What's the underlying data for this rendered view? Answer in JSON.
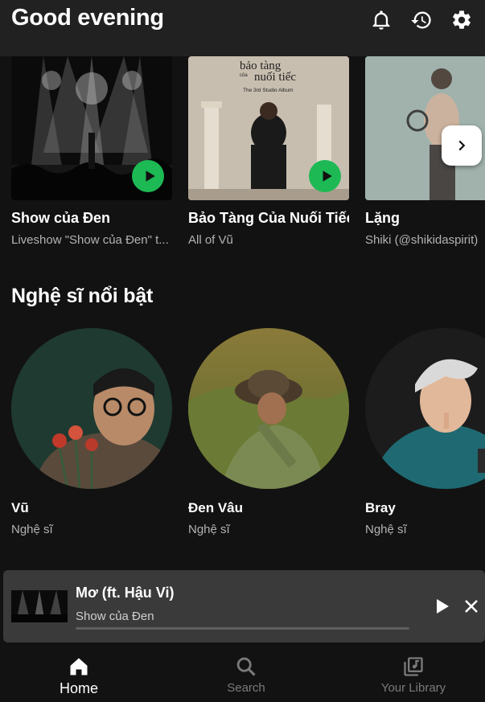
{
  "header": {
    "greeting": "Good evening",
    "icons": [
      "bell-icon",
      "history-icon",
      "settings-icon"
    ]
  },
  "albums": [
    {
      "title": "Show của Đen",
      "subtitle": "Liveshow \"Show của Đen\" t...",
      "has_play": true
    },
    {
      "title": "Bảo Tàng Của Nuối Tiếc",
      "subtitle": "All of Vũ",
      "has_play": true,
      "art_text_1": "bảo tàng",
      "art_text_2": "của",
      "art_text_3": "nuối tiếc",
      "art_text_4": "The 3rd Studio Album"
    },
    {
      "title": "Lặng",
      "subtitle": "Shiki (@shikidaspirit)",
      "has_play": false
    }
  ],
  "artists_section": {
    "title": "Nghệ sĩ nổi bật",
    "items": [
      {
        "name": "Vũ",
        "role": "Nghệ sĩ"
      },
      {
        "name": "Đen Vâu",
        "role": "Nghệ sĩ"
      },
      {
        "name": "Bray",
        "role": "Nghệ sĩ"
      }
    ]
  },
  "mini_player": {
    "title": "Mơ (ft. Hậu Vi)",
    "subtitle": "Show của Đen",
    "progress": 0.0
  },
  "nav": {
    "items": [
      {
        "label": "Home",
        "icon": "home-icon",
        "active": true
      },
      {
        "label": "Search",
        "icon": "search-icon",
        "active": false
      },
      {
        "label": "Your Library",
        "icon": "library-icon",
        "active": false
      }
    ]
  },
  "colors": {
    "accent": "#1db954",
    "background": "#121212",
    "topbar": "#212121",
    "mini_player": "#3a3a3a"
  }
}
